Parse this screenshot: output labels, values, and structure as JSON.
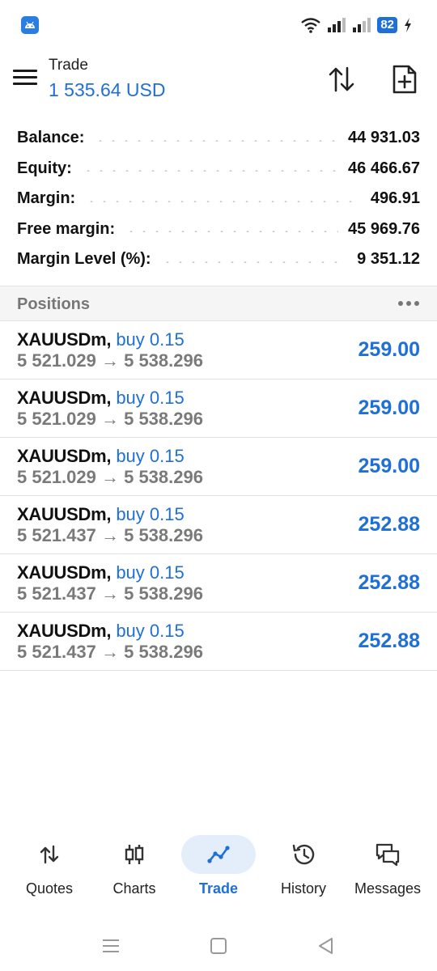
{
  "status_bar": {
    "battery": "82",
    "icons": [
      "app-notification-icon",
      "wifi-icon",
      "signal-icon",
      "signal-icon",
      "battery-icon",
      "charging-icon"
    ]
  },
  "header": {
    "title": "Trade",
    "balance_display": "1 535.64 USD",
    "icons": [
      "menu-icon",
      "sort-icon",
      "new-order-icon"
    ]
  },
  "summary": [
    {
      "label": "Balance:",
      "value": "44 931.03"
    },
    {
      "label": "Equity:",
      "value": "46 466.67"
    },
    {
      "label": "Margin:",
      "value": "496.91"
    },
    {
      "label": "Free margin:",
      "value": "45 969.76"
    },
    {
      "label": "Margin Level (%):",
      "value": "9 351.12"
    }
  ],
  "positions": {
    "title": "Positions",
    "items": [
      {
        "symbol": "XAUUSDm,",
        "side": "buy 0.15",
        "prices": "5 521.029 → 5 538.296",
        "profit": "259.00"
      },
      {
        "symbol": "XAUUSDm,",
        "side": "buy 0.15",
        "prices": "5 521.029 → 5 538.296",
        "profit": "259.00"
      },
      {
        "symbol": "XAUUSDm,",
        "side": "buy 0.15",
        "prices": "5 521.029 → 5 538.296",
        "profit": "259.00"
      },
      {
        "symbol": "XAUUSDm,",
        "side": "buy 0.15",
        "prices": "5 521.437 → 5 538.296",
        "profit": "252.88"
      },
      {
        "symbol": "XAUUSDm,",
        "side": "buy 0.15",
        "prices": "5 521.437 → 5 538.296",
        "profit": "252.88"
      },
      {
        "symbol": "XAUUSDm,",
        "side": "buy 0.15",
        "prices": "5 521.437 → 5 538.296",
        "profit": "252.88"
      }
    ]
  },
  "nav": [
    {
      "label": "Quotes",
      "icon": "quotes-icon"
    },
    {
      "label": "Charts",
      "icon": "charts-icon"
    },
    {
      "label": "Trade",
      "icon": "trade-icon",
      "active": true
    },
    {
      "label": "History",
      "icon": "history-icon"
    },
    {
      "label": "Messages",
      "icon": "messages-icon"
    }
  ],
  "colors": {
    "accent": "#1f6fd8",
    "muted_text": "#7a7a7a",
    "active_nav_bg": "#e4eefb"
  }
}
